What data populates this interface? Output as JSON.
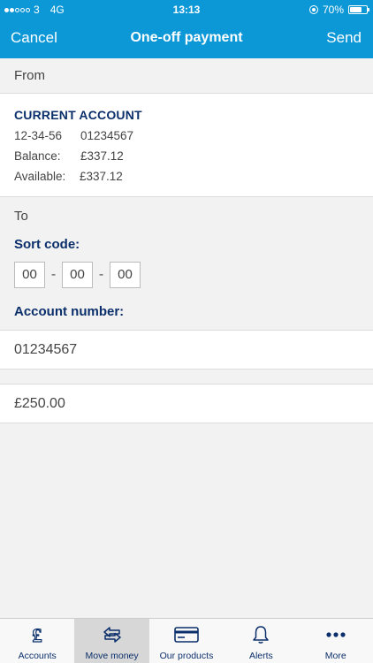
{
  "status_bar": {
    "carrier": "3",
    "network": "4G",
    "time": "13:13",
    "battery": "70%",
    "battery_level": 0.7
  },
  "nav": {
    "cancel_label": "Cancel",
    "title": "One-off payment",
    "send_label": "Send"
  },
  "from": {
    "header": "From",
    "account_name": "CURRENT ACCOUNT",
    "sort_code": "12-34-56",
    "account_number": "01234567",
    "balance_label": "Balance:",
    "balance_value": "£337.12",
    "available_label": "Available:",
    "available_value": "£337.12"
  },
  "to": {
    "header": "To",
    "sort_code_label": "Sort code:",
    "sort_code_parts": [
      "00",
      "00",
      "00"
    ],
    "account_number_label": "Account number:",
    "account_number_value": "01234567"
  },
  "amount": {
    "value": "£250.00"
  },
  "tabs": [
    {
      "label": "Accounts",
      "icon": "pound-icon"
    },
    {
      "label": "Move money",
      "icon": "transfer-arrows-icon",
      "active": true
    },
    {
      "label": "Our products",
      "icon": "card-icon"
    },
    {
      "label": "Alerts",
      "icon": "bell-icon"
    },
    {
      "label": "More",
      "icon": "more-dots-icon"
    }
  ],
  "colors": {
    "brand_blue": "#0c97d6",
    "navy_text": "#0b2f6b"
  }
}
